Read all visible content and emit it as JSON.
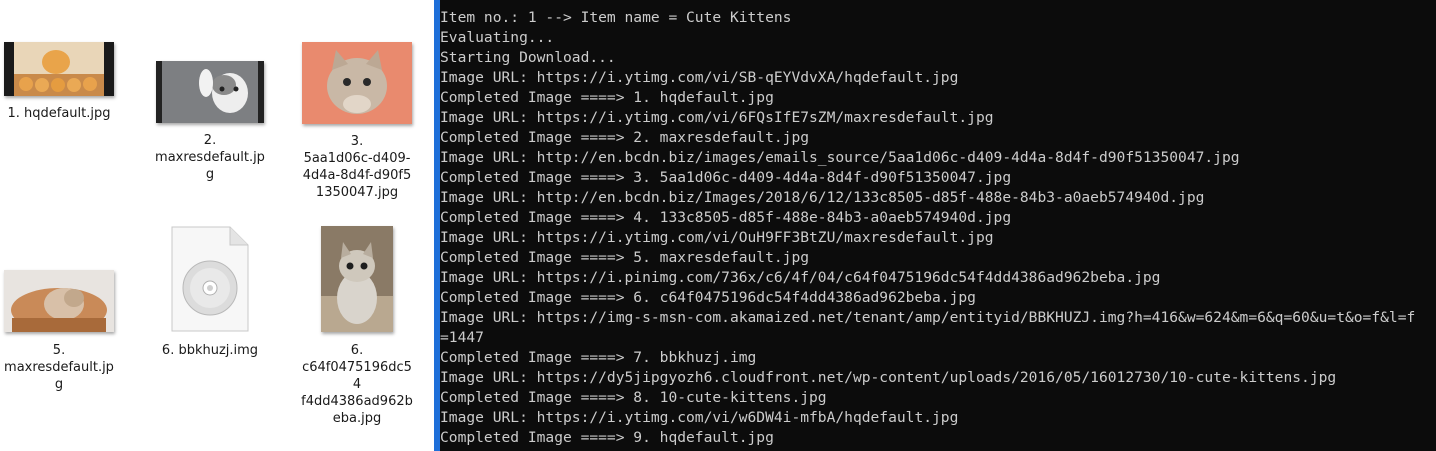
{
  "explorer": {
    "files": [
      {
        "caption_lines": [
          "1. hqdefault.jpg"
        ]
      },
      {
        "caption_lines": [
          "2.",
          "maxresdefault.jp",
          "g"
        ]
      },
      {
        "caption_lines": [
          "3.",
          "5aa1d06c-d409-",
          "4d4a-8d4f-d90f5",
          "1350047.jpg"
        ]
      },
      {
        "caption_lines": [
          "5.",
          "maxresdefault.jp",
          "g"
        ]
      },
      {
        "caption_lines": [
          "6. bbkhuzj.img"
        ]
      },
      {
        "caption_lines": [
          "6.",
          "c64f0475196dc54",
          "f4dd4386ad962b",
          "eba.jpg"
        ]
      }
    ]
  },
  "console": {
    "lines": [
      "Item no.: 1 --> Item name = Cute Kittens",
      "Evaluating...",
      "Starting Download...",
      "Image URL: https://i.ytimg.com/vi/SB-qEYVdvXA/hqdefault.jpg",
      "Completed Image ====> 1. hqdefault.jpg",
      "Image URL: https://i.ytimg.com/vi/6FQsIfE7sZM/maxresdefault.jpg",
      "Completed Image ====> 2. maxresdefault.jpg",
      "Image URL: http://en.bcdn.biz/images/emails_source/5aa1d06c-d409-4d4a-8d4f-d90f51350047.jpg",
      "Completed Image ====> 3. 5aa1d06c-d409-4d4a-8d4f-d90f51350047.jpg",
      "Image URL: http://en.bcdn.biz/Images/2018/6/12/133c8505-d85f-488e-84b3-a0aeb574940d.jpg",
      "Completed Image ====> 4. 133c8505-d85f-488e-84b3-a0aeb574940d.jpg",
      "Image URL: https://i.ytimg.com/vi/OuH9FF3BtZU/maxresdefault.jpg",
      "Completed Image ====> 5. maxresdefault.jpg",
      "Image URL: https://i.pinimg.com/736x/c6/4f/04/c64f0475196dc54f4dd4386ad962beba.jpg",
      "Completed Image ====> 6. c64f0475196dc54f4dd4386ad962beba.jpg",
      "Image URL: https://img-s-msn-com.akamaized.net/tenant/amp/entityid/BBKHUZJ.img?h=416&w=624&m=6&q=60&u=t&o=f&l=f",
      "=1447",
      "Completed Image ====> 7. bbkhuzj.img",
      "Image URL: https://dy5jipgyozh6.cloudfront.net/wp-content/uploads/2016/05/16012730/10-cute-kittens.jpg",
      "Completed Image ====> 8. 10-cute-kittens.jpg",
      "Image URL: https://i.ytimg.com/vi/w6DW4i-mfbA/hqdefault.jpg",
      "Completed Image ====> 9. hqdefault.jpg"
    ]
  },
  "colors": {
    "console_bg": "#0c0c0c",
    "console_text": "#cccccc",
    "divider": "#1e6fd9"
  }
}
